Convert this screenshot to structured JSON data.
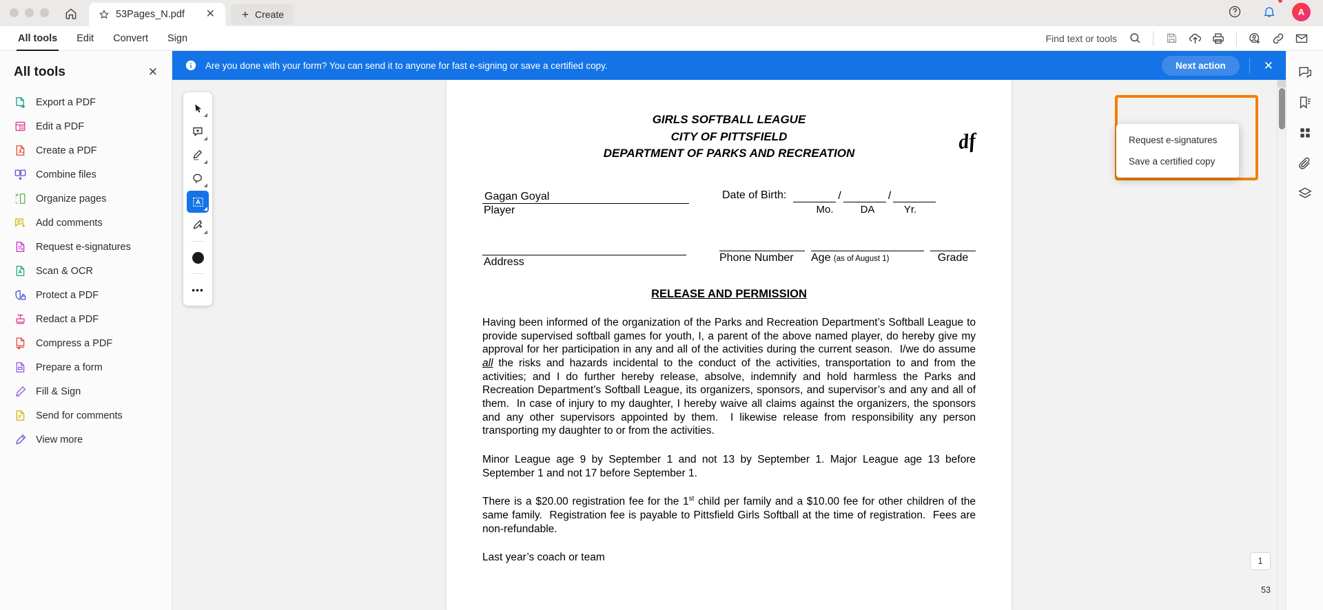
{
  "titlebar": {
    "home_icon": "home-icon",
    "tab": {
      "title": "53Pages_N.pdf",
      "star_icon": "star-icon",
      "close": "✕"
    },
    "create_button": {
      "label": "Create",
      "icon": "plus-icon"
    },
    "help_icon": "help-circle-icon",
    "bell_icon": "bell-icon",
    "avatar_initial": "A"
  },
  "menubar": {
    "items": [
      {
        "label": "All tools",
        "active": true
      },
      {
        "label": "Edit",
        "active": false
      },
      {
        "label": "Convert",
        "active": false
      },
      {
        "label": "Sign",
        "active": false
      }
    ],
    "find_label": "Find text or tools",
    "icons": [
      "search-icon",
      "save-icon",
      "upload-cloud-icon",
      "print-icon",
      "add-person-icon",
      "link-icon",
      "email-icon"
    ]
  },
  "sidebar": {
    "title": "All tools",
    "close": "✕",
    "items": [
      {
        "label": "Export a PDF",
        "icon": "export-pdf-icon",
        "color": "#0d9b8a"
      },
      {
        "label": "Edit a PDF",
        "icon": "edit-pdf-icon",
        "color": "#e1348b"
      },
      {
        "label": "Create a PDF",
        "icon": "create-pdf-icon",
        "color": "#e8443a"
      },
      {
        "label": "Combine files",
        "icon": "combine-files-icon",
        "color": "#5a4fd6"
      },
      {
        "label": "Organize pages",
        "icon": "organize-pages-icon",
        "color": "#52b14a"
      },
      {
        "label": "Add comments",
        "icon": "add-comments-icon",
        "color": "#d4b106"
      },
      {
        "label": "Request e-signatures",
        "icon": "request-esign-icon",
        "color": "#c332d4"
      },
      {
        "label": "Scan & OCR",
        "icon": "scan-ocr-icon",
        "color": "#1eab6a"
      },
      {
        "label": "Protect a PDF",
        "icon": "protect-pdf-icon",
        "color": "#3b4fd8"
      },
      {
        "label": "Redact a PDF",
        "icon": "redact-pdf-icon",
        "color": "#e1348b"
      },
      {
        "label": "Compress a PDF",
        "icon": "compress-pdf-icon",
        "color": "#e8443a"
      },
      {
        "label": "Prepare a form",
        "icon": "prepare-form-icon",
        "color": "#8c5ae0"
      },
      {
        "label": "Fill & Sign",
        "icon": "fill-sign-icon",
        "color": "#8c5ae0"
      },
      {
        "label": "Send for comments",
        "icon": "send-comments-icon",
        "color": "#d4b106"
      },
      {
        "label": "View more",
        "icon": "view-more-icon",
        "color": "#5a4fd6"
      }
    ]
  },
  "notification": {
    "info_icon": "info-icon",
    "message": "Are you done with your form? You can send it to anyone for fast e-signing or save a certified copy.",
    "next_action_label": "Next action",
    "close": "✕",
    "highlight_color": "#f08000",
    "bar_color": "#1473e6"
  },
  "dropdown": {
    "items": [
      {
        "label": "Request e-signatures"
      },
      {
        "label": "Save a certified copy"
      }
    ]
  },
  "palette": {
    "tools": [
      {
        "name": "select-tool",
        "icon": "cursor-icon",
        "active": false
      },
      {
        "name": "comment-tool",
        "icon": "comment-add-icon",
        "active": false
      },
      {
        "name": "highlight-tool",
        "icon": "highlighter-icon",
        "active": false
      },
      {
        "name": "lasso-tool",
        "icon": "lasso-icon",
        "active": false
      },
      {
        "name": "textbox-tool",
        "icon": "text-box-icon",
        "active": true
      },
      {
        "name": "signature-tool",
        "icon": "signature-pen-icon",
        "active": false
      }
    ],
    "color_swatch": "#1b1b1b",
    "more_label": "•••"
  },
  "document": {
    "header_lines": [
      "GIRLS SOFTBALL LEAGUE",
      "CITY OF PITTSFIELD",
      "DEPARTMENT OF PARKS AND RECREATION"
    ],
    "signature_mark": "df",
    "player_value": "Gagan Goyal",
    "player_label": "Player",
    "address_label": "Address",
    "dob_label": "Date of Birth:",
    "dob_marks": [
      "Mo.",
      "DA",
      "Yr."
    ],
    "dob_slash": "/",
    "phone_label": "Phone Number",
    "age_label": "Age",
    "age_note": "(as of August 1)",
    "grade_label": "Grade",
    "release_title": "RELEASE AND PERMISSION",
    "para1_a": "Having been informed of the organization of the Parks and Recreation Department’s Softball League to provide supervised softball games for youth, I, a parent of the above named player, do hereby give my approval for her participation in any and all of the activities during the current season.  I/we do assume ",
    "para1_em": "all",
    "para1_b": " the risks and hazards incidental to the conduct of the activities, transportation to and from the activities; and I do further hereby release, absolve, indemnify and hold harmless the Parks and Recreation Department’s Softball League, its organizers, sponsors, and supervisor’s and any and all of them.  In case of injury to my daughter, I hereby waive all claims against the organizers, the sponsors and any other supervisors appointed by them.  I likewise release from responsibility any person transporting my daughter to or from the activities.",
    "para2": "Minor League age 9 by September 1 and not 13 by September 1. Major League age 13 before September 1 and not 17 before September 1.",
    "para3_a": "There is a $20.00 registration fee for the 1",
    "para3_sup": "st",
    "para3_b": " child per family and a $10.00 fee for other children of the same family.  Registration fee is payable to Pittsfield Girls Softball at the time of registration.  Fees are non-refundable.",
    "para4_partial": "Last year’s coach or team"
  },
  "viewer": {
    "page_number": "1",
    "page_total": "53"
  },
  "rail": {
    "items": [
      {
        "name": "comments-panel",
        "icon": "comment-icon"
      },
      {
        "name": "bookmarks-panel",
        "icon": "bookmark-icon"
      },
      {
        "name": "thumbnails-panel",
        "icon": "grid-icon"
      },
      {
        "name": "attachments-panel",
        "icon": "paperclip-icon"
      },
      {
        "name": "layers-panel",
        "icon": "layers-icon"
      }
    ]
  }
}
